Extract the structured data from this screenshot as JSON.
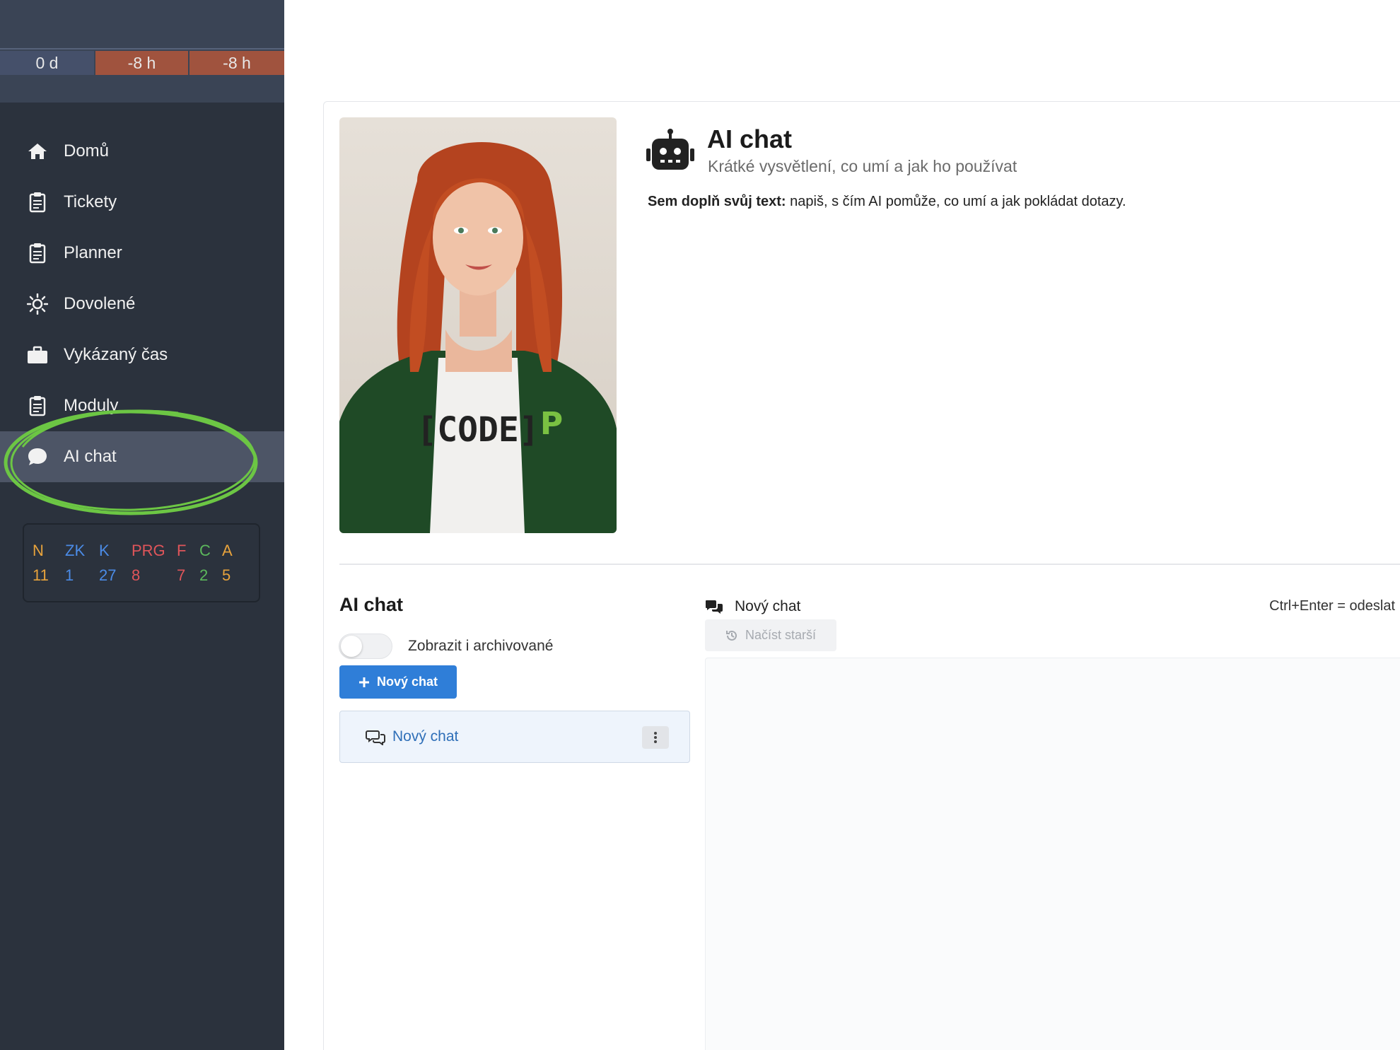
{
  "sidebar": {
    "time_boxes": [
      "0 d",
      "-8 h",
      "-8 h"
    ],
    "nav": [
      {
        "label": "Domů",
        "icon": "home-icon"
      },
      {
        "label": "Tickety",
        "icon": "clipboard-icon"
      },
      {
        "label": "Planner",
        "icon": "clipboard-icon"
      },
      {
        "label": "Dovolené",
        "icon": "sun-icon"
      },
      {
        "label": "Vykázaný čas",
        "icon": "briefcase-icon"
      },
      {
        "label": "Moduly",
        "icon": "clipboard-icon"
      },
      {
        "label": "AI chat",
        "icon": "chat-bubble-icon",
        "active": true
      }
    ],
    "stats": {
      "labels": [
        "N",
        "ZK",
        "K",
        "PRG",
        "F",
        "C",
        "A"
      ],
      "values": [
        "11",
        "1",
        "27",
        "8",
        "7",
        "2",
        "5"
      ],
      "colors": [
        "#e8a33c",
        "#4b8be6",
        "#4b8be6",
        "#e0555a",
        "#e0555a",
        "#5cb85c",
        "#e8a33c"
      ]
    },
    "highlight_color": "#6cc644"
  },
  "header": {
    "title": "AI chat",
    "subtitle": "Krátké vysvětlení, co umí a jak ho používat",
    "desc_bold": "Sem doplň svůj text:",
    "desc_rest": " napiš, s čím AI pomůže, co umí a jak pokládat dotazy.",
    "portrait_shirt_text": "[CODE]"
  },
  "chat_list": {
    "title": "AI chat",
    "toggle_label": "Zobrazit i archivované",
    "toggle_on": false,
    "new_chat_button": "Nový chat",
    "items": [
      {
        "label": "Nový chat"
      }
    ]
  },
  "conversation": {
    "title": "Nový chat",
    "hint": "Ctrl+Enter = odeslat",
    "load_older": "Načíst starší"
  },
  "colors": {
    "sidebar_bg": "#2b323d",
    "accent_blue": "#2f7ed8",
    "negative_time": "#a0533e"
  }
}
